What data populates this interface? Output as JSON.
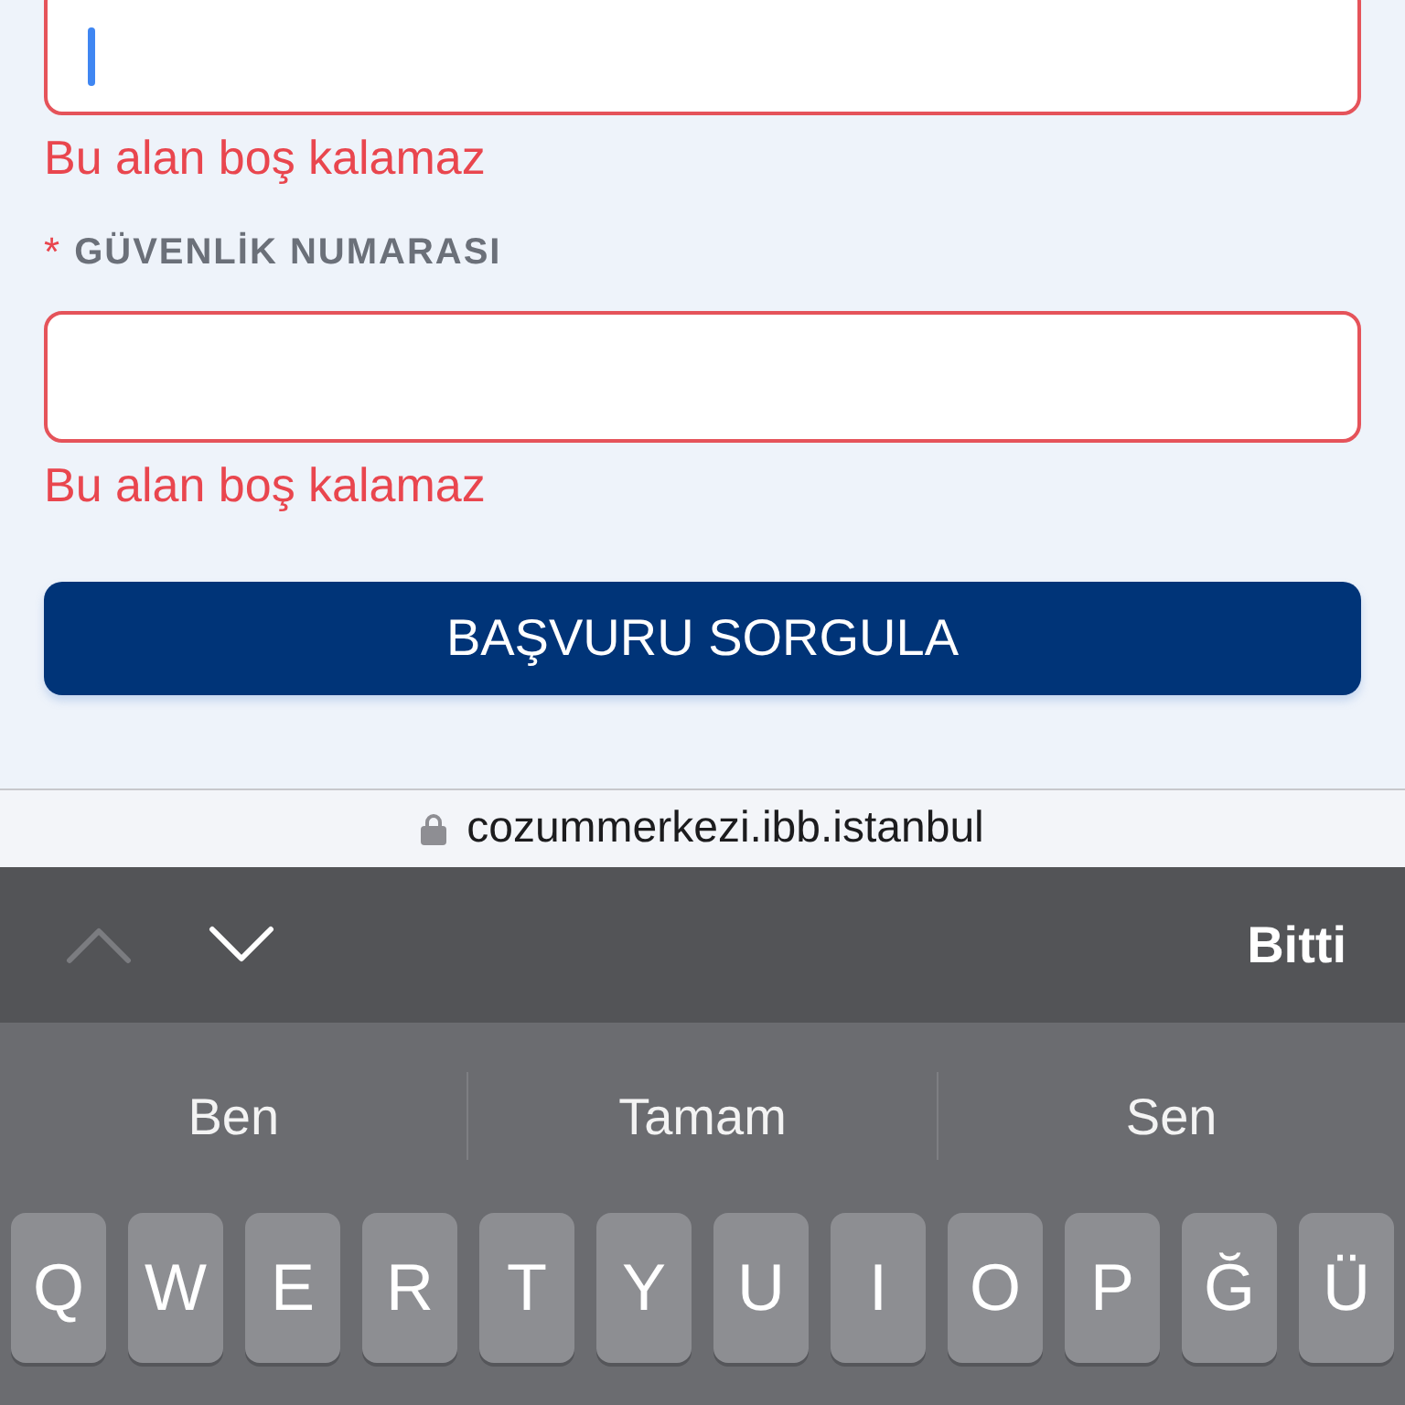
{
  "form": {
    "fields": [
      {
        "focused": true,
        "invalid": true,
        "error": "Bu alan boş kalamaz"
      },
      {
        "required_mark": "*",
        "label": "GÜVENLİK NUMARASI",
        "focused": false,
        "invalid": true,
        "error": "Bu alan boş kalamaz"
      }
    ],
    "submit_button": {
      "label": "BAŞVURU SORGULA"
    }
  },
  "address_bar": {
    "secure": true,
    "url": "cozummerkezi.ibb.istanbul"
  },
  "keyboard": {
    "toolbar": {
      "nav_buttons": [
        {
          "kind": "previous",
          "disabled": true
        },
        {
          "kind": "next",
          "disabled": false
        }
      ],
      "done_label": "Bitti"
    },
    "suggestions": [
      "Ben",
      "Tamam",
      "Sen"
    ],
    "keys": [
      "Q",
      "W",
      "E",
      "R",
      "T",
      "Y",
      "U",
      "I",
      "O",
      "P",
      "Ğ",
      "Ü"
    ]
  }
}
